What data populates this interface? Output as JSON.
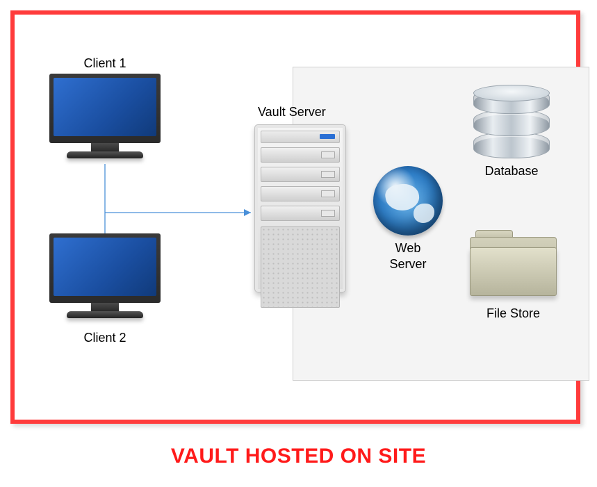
{
  "caption": "VAULT HOSTED ON SITE",
  "nodes": {
    "client1": {
      "label": "Client 1"
    },
    "client2": {
      "label": "Client 2"
    },
    "vault_server": {
      "label": "Vault Server"
    },
    "web_server": {
      "label": "Web\nServer"
    },
    "database": {
      "label": "Database"
    },
    "file_store": {
      "label": "File Store"
    }
  },
  "colors": {
    "frame_border": "#ff3b3b",
    "caption_color": "#ff1a1a",
    "connection_line": "#4a90d9",
    "server_group_bg": "#f4f4f4"
  }
}
